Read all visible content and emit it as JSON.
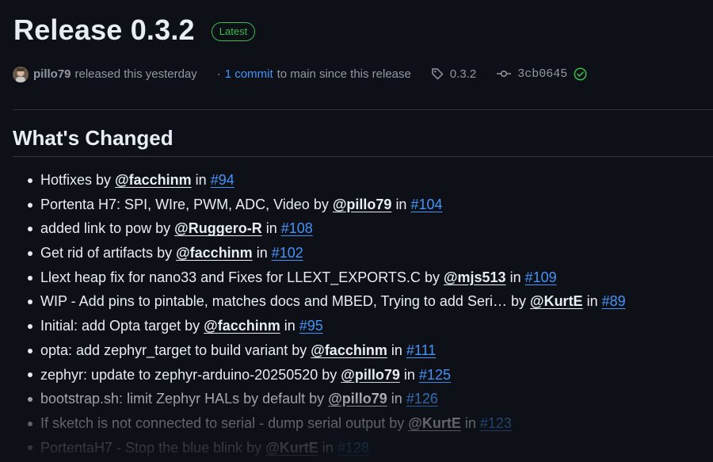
{
  "release": {
    "title": "Release 0.3.2",
    "badge": "Latest"
  },
  "meta": {
    "author": "pillo79",
    "released_text": "released this yesterday",
    "separator": "·",
    "commit_link": "1 commit",
    "commit_suffix": "to main since this release",
    "tag": "0.3.2",
    "sha": "3cb0645"
  },
  "section": {
    "heading": "What's Changed"
  },
  "changes": [
    {
      "title": "Hotfixes",
      "by": "by",
      "user": "@facchinm",
      "in": "in",
      "pr": "#94"
    },
    {
      "title": "Portenta H7: SPI, WIre, PWM, ADC, Video",
      "by": "by",
      "user": "@pillo79",
      "in": "in",
      "pr": "#104"
    },
    {
      "title": "added link to pow",
      "by": "by",
      "user": "@Ruggero-R",
      "in": "in",
      "pr": "#108"
    },
    {
      "title": "Get rid of artifacts",
      "by": "by",
      "user": "@facchinm",
      "in": "in",
      "pr": "#102"
    },
    {
      "title": "Llext heap fix for nano33 and Fixes for LLEXT_EXPORTS.C",
      "by": "by",
      "user": "@mjs513",
      "in": "in",
      "pr": "#109"
    },
    {
      "title": "WIP - Add pins to pintable, matches docs and MBED, Trying to add Seri…",
      "by": "by",
      "user": "@KurtE",
      "in": "in",
      "pr": "#89"
    },
    {
      "title": "Initial: add Opta target",
      "by": "by",
      "user": "@facchinm",
      "in": "in",
      "pr": "#95"
    },
    {
      "title": "opta: add zephyr_target to build variant",
      "by": "by",
      "user": "@facchinm",
      "in": "in",
      "pr": "#111"
    },
    {
      "title": "zephyr: update to zephyr-arduino-20250520",
      "by": "by",
      "user": "@pillo79",
      "in": "in",
      "pr": "#125"
    },
    {
      "title": "bootstrap.sh: limit Zephyr HALs by default",
      "by": "by",
      "user": "@pillo79",
      "in": "in",
      "pr": "#126"
    },
    {
      "title": "If sketch is not connected to serial - dump serial output",
      "by": "by",
      "user": "@KurtE",
      "in": "in",
      "pr": "#123"
    },
    {
      "title": "PortentaH7 - Stop the blue blink",
      "by": "by",
      "user": "@KurtE",
      "in": "in",
      "pr": "#128"
    }
  ],
  "colors": {
    "background": "#0d1117",
    "text": "#e6edf3",
    "muted": "#9198a1",
    "link": "#4493f8",
    "success": "#3fb950",
    "border": "#30363d"
  },
  "icons": {
    "tag": "tag-icon",
    "commit": "git-commit-icon",
    "verified": "check-circle-icon"
  }
}
